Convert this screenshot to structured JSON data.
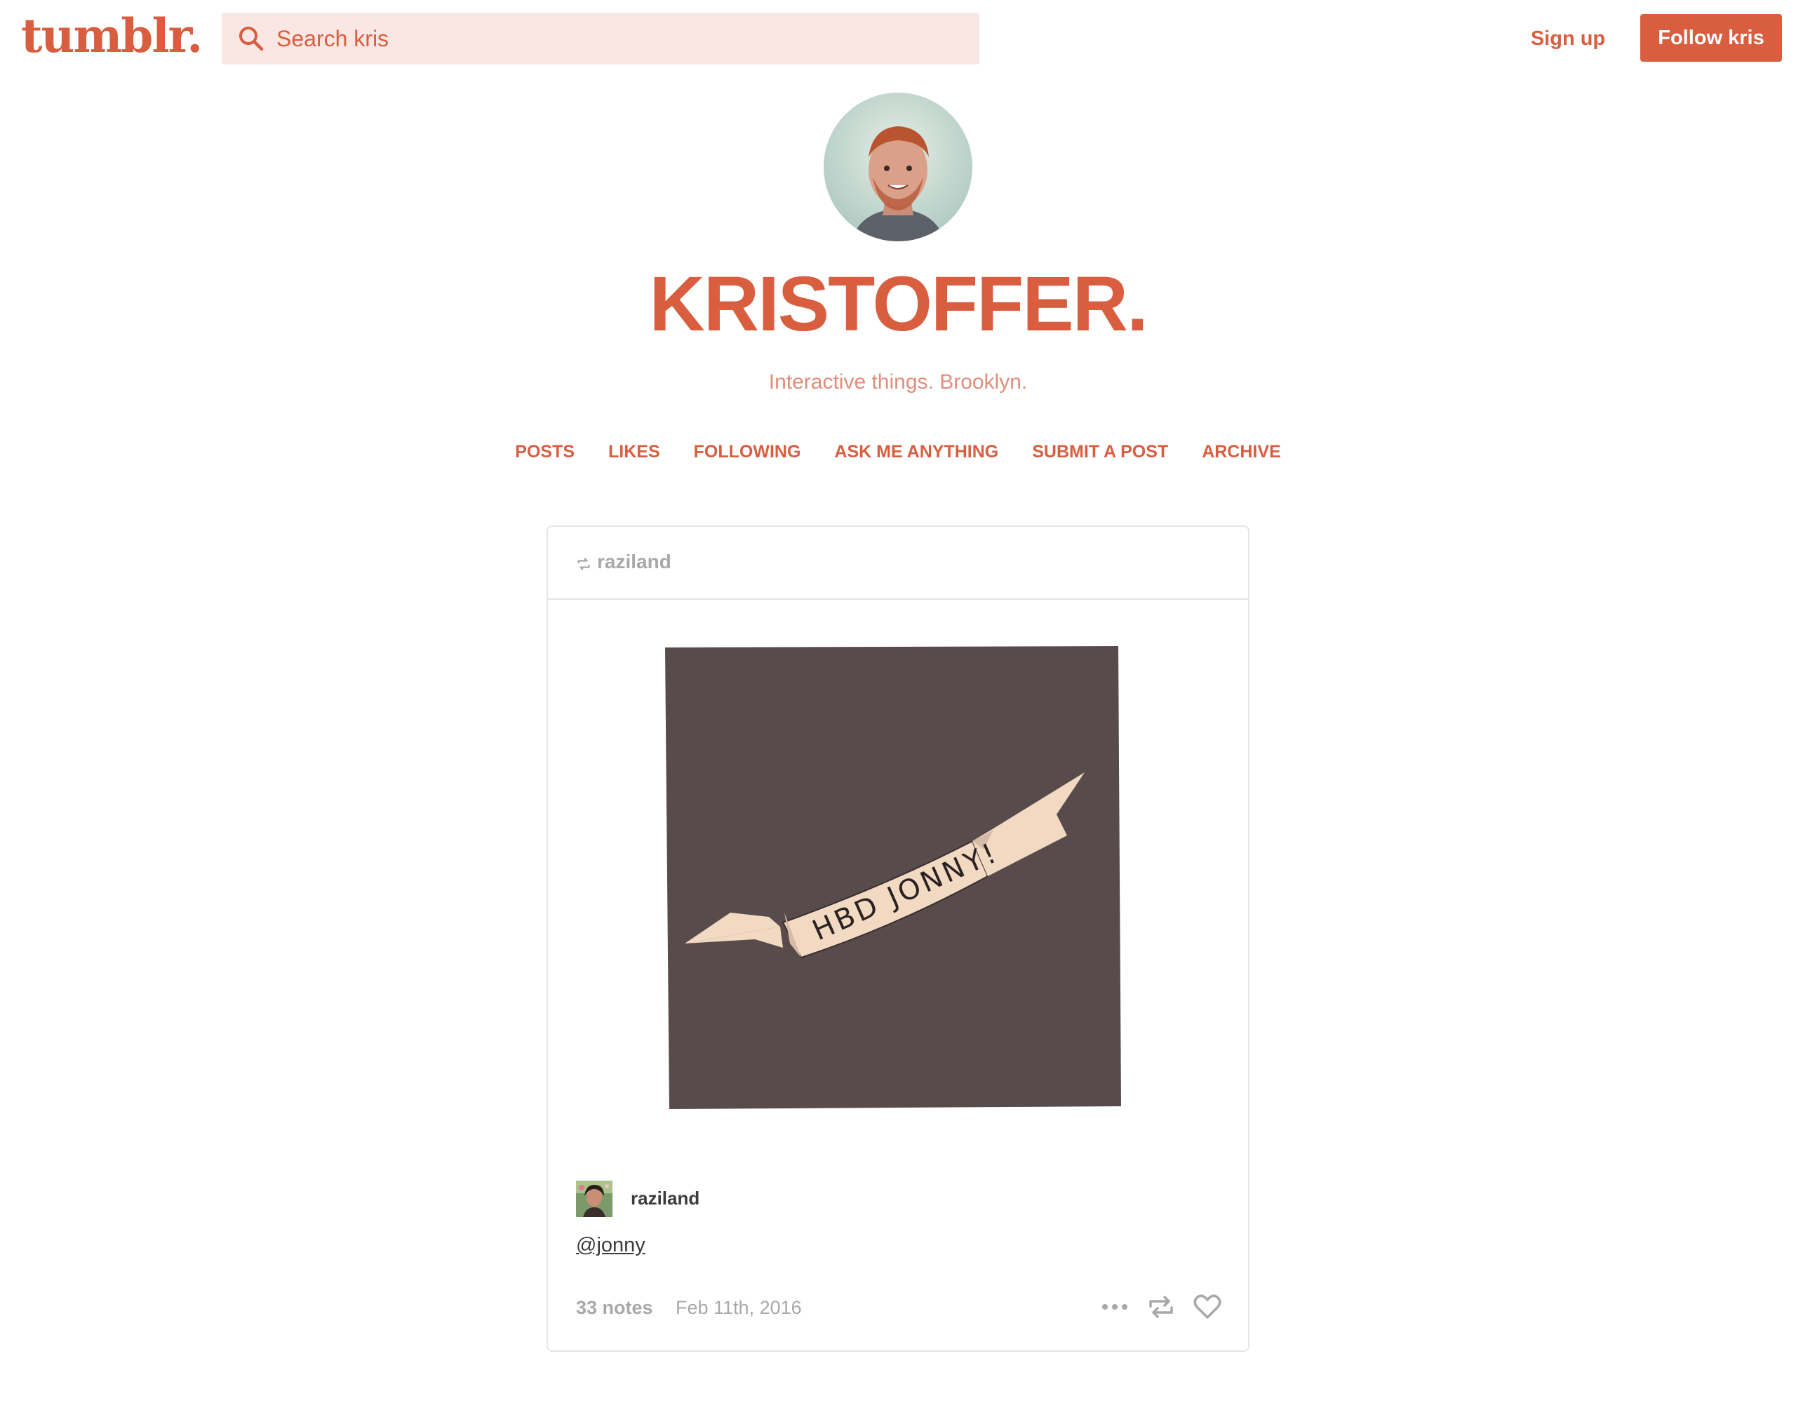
{
  "brand": {
    "logo": "tumblr."
  },
  "search": {
    "placeholder": "Search kris"
  },
  "header": {
    "signup_label": "Sign up",
    "follow_label": "Follow kris"
  },
  "blog": {
    "title": "KRISTOFFER.",
    "description": "Interactive things. Brooklyn."
  },
  "nav": {
    "items": [
      {
        "label": "POSTS"
      },
      {
        "label": "LIKES"
      },
      {
        "label": "FOLLOWING"
      },
      {
        "label": "ASK ME ANYTHING"
      },
      {
        "label": "SUBMIT A POST"
      },
      {
        "label": "ARCHIVE"
      }
    ]
  },
  "post": {
    "reblogged_from": "raziland",
    "image_text": "HBD JONNY!",
    "author": "raziland",
    "body_mention": "@jonny",
    "notes": "33 notes",
    "date": "Feb 11th, 2016"
  },
  "colors": {
    "accent": "#d95e40",
    "accent_light": "#e08d7a",
    "search_bg": "#f9e7e3",
    "muted": "#a8a8a8",
    "text": "#3c3c3c",
    "card_bg": "#584b4b",
    "ribbon": "#f2d9c2"
  },
  "icons": {
    "search": "search-icon",
    "reblog": "reblog-icon",
    "more": "more-dots-icon",
    "like": "heart-icon"
  }
}
